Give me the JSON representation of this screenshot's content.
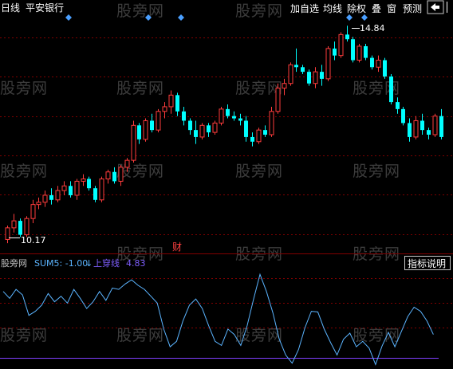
{
  "header": {
    "period": "日线",
    "stock_name": "平安银行",
    "toolbar": [
      "加自选",
      "均线",
      "除权",
      "叠",
      "窗",
      "预测"
    ],
    "nav_icon": "left-arrow-icon"
  },
  "price_labels": {
    "high": "14.84",
    "low": "10.17"
  },
  "event_marker": "财",
  "indicator_legend": {
    "name": "股旁网",
    "sum5": "SUM5: -1.00",
    "signal": "上穿线",
    "signal_value": "4.83"
  },
  "indicator_button": "指标说明",
  "watermark": "股旁网",
  "colors": {
    "up": "#ff3c3c",
    "down": "#00ffff",
    "grid": "#800000",
    "indicator_line": "#5bb4ff",
    "signal_line": "#7f3fff",
    "marker": "#4a9fff"
  },
  "chart_data": {
    "type": "candlestick",
    "ohlc": [
      [
        10.25,
        10.55,
        10.17,
        10.5
      ],
      [
        10.5,
        10.8,
        10.4,
        10.65
      ],
      [
        10.65,
        10.7,
        10.3,
        10.35
      ],
      [
        10.35,
        10.75,
        10.3,
        10.7
      ],
      [
        10.7,
        11.1,
        10.6,
        11.0
      ],
      [
        11.0,
        11.15,
        10.9,
        11.05
      ],
      [
        11.05,
        11.3,
        10.95,
        11.2
      ],
      [
        11.2,
        11.35,
        11.0,
        11.1
      ],
      [
        11.1,
        11.4,
        11.05,
        11.3
      ],
      [
        11.3,
        11.5,
        11.2,
        11.4
      ],
      [
        11.4,
        11.5,
        11.15,
        11.2
      ],
      [
        11.2,
        11.55,
        11.1,
        11.5
      ],
      [
        11.5,
        11.65,
        11.4,
        11.55
      ],
      [
        11.55,
        11.6,
        11.3,
        11.35
      ],
      [
        11.35,
        11.4,
        11.05,
        11.1
      ],
      [
        11.1,
        11.6,
        11.05,
        11.55
      ],
      [
        11.55,
        11.75,
        11.45,
        11.7
      ],
      [
        11.7,
        11.8,
        11.45,
        11.5
      ],
      [
        11.5,
        11.85,
        11.4,
        11.8
      ],
      [
        11.8,
        12.0,
        11.7,
        11.95
      ],
      [
        11.95,
        12.8,
        11.9,
        12.7
      ],
      [
        12.7,
        12.75,
        12.3,
        12.4
      ],
      [
        12.4,
        12.85,
        12.35,
        12.8
      ],
      [
        12.8,
        12.95,
        12.55,
        12.6
      ],
      [
        12.6,
        13.05,
        12.55,
        13.0
      ],
      [
        13.0,
        13.2,
        12.85,
        13.1
      ],
      [
        13.1,
        13.45,
        12.95,
        13.35
      ],
      [
        13.35,
        13.4,
        12.9,
        13.0
      ],
      [
        13.0,
        13.1,
        12.7,
        12.8
      ],
      [
        12.8,
        12.85,
        12.5,
        12.6
      ],
      [
        12.6,
        12.8,
        12.3,
        12.45
      ],
      [
        12.45,
        12.75,
        12.4,
        12.7
      ],
      [
        12.7,
        12.75,
        12.45,
        12.55
      ],
      [
        12.55,
        12.8,
        12.5,
        12.75
      ],
      [
        12.75,
        13.1,
        12.7,
        13.05
      ],
      [
        13.05,
        13.15,
        12.85,
        12.9
      ],
      [
        12.9,
        13.0,
        12.8,
        12.85
      ],
      [
        12.85,
        12.95,
        12.7,
        12.8
      ],
      [
        12.8,
        12.9,
        12.35,
        12.45
      ],
      [
        12.45,
        12.55,
        12.25,
        12.35
      ],
      [
        12.35,
        12.65,
        12.3,
        12.6
      ],
      [
        12.6,
        12.7,
        12.45,
        12.5
      ],
      [
        12.5,
        13.1,
        12.45,
        13.0
      ],
      [
        13.0,
        13.6,
        12.95,
        13.5
      ],
      [
        13.5,
        13.7,
        13.35,
        13.6
      ],
      [
        13.6,
        14.05,
        13.55,
        14.0
      ],
      [
        14.0,
        14.35,
        13.85,
        13.95
      ],
      [
        13.95,
        14.0,
        13.8,
        13.85
      ],
      [
        13.85,
        13.9,
        13.55,
        13.6
      ],
      [
        13.6,
        13.95,
        13.5,
        13.85
      ],
      [
        13.85,
        14.0,
        13.55,
        13.7
      ],
      [
        13.7,
        14.4,
        13.65,
        14.35
      ],
      [
        14.35,
        14.5,
        14.1,
        14.2
      ],
      [
        14.2,
        14.7,
        14.15,
        14.65
      ],
      [
        14.65,
        14.84,
        14.5,
        14.55
      ],
      [
        14.55,
        14.6,
        14.05,
        14.1
      ],
      [
        14.1,
        14.45,
        14.05,
        14.4
      ],
      [
        14.4,
        14.45,
        14.1,
        14.15
      ],
      [
        14.15,
        14.2,
        13.9,
        13.95
      ],
      [
        13.95,
        14.2,
        13.85,
        14.1
      ],
      [
        14.1,
        14.15,
        13.7,
        13.75
      ],
      [
        13.75,
        13.8,
        13.15,
        13.2
      ],
      [
        13.2,
        13.3,
        12.95,
        13.05
      ],
      [
        13.05,
        13.1,
        12.7,
        12.75
      ],
      [
        12.75,
        12.85,
        12.35,
        12.45
      ],
      [
        12.45,
        12.9,
        12.4,
        12.8
      ],
      [
        12.8,
        12.95,
        12.5,
        12.6
      ],
      [
        12.6,
        12.65,
        12.4,
        12.5
      ],
      [
        12.5,
        12.95,
        12.45,
        12.9
      ],
      [
        12.9,
        13.05,
        12.4,
        12.45
      ]
    ],
    "ylim": [
      9.95,
      15.05
    ],
    "highlight_high": 14.84,
    "highlight_low": 10.17,
    "indicator": {
      "name": "SUM5",
      "last": -1.0,
      "signal_value": 4.83,
      "values": [
        6.5,
        5.5,
        6.8,
        6.0,
        3.0,
        3.6,
        4.5,
        6.2,
        5.0,
        5.8,
        4.8,
        6.8,
        5.5,
        4.0,
        5.0,
        6.5,
        5.2,
        7.0,
        6.8,
        7.6,
        8.2,
        7.4,
        6.8,
        5.8,
        4.8,
        1.0,
        -1.6,
        -0.8,
        2.2,
        4.5,
        5.4,
        4.0,
        1.5,
        -0.8,
        -1.4,
        1.0,
        0.2,
        -1.4,
        1.5,
        5.4,
        9.0,
        6.5,
        3.4,
        -0.5,
        -2.8,
        -4.0,
        -2.0,
        1.2,
        3.6,
        3.5,
        1.0,
        -1.0,
        -2.8,
        -0.5,
        0.4,
        -1.6,
        -0.8,
        -1.8,
        -4.2,
        -1.5,
        0.5,
        -1.6,
        0.6,
        2.8,
        4.2,
        3.6,
        2.2,
        0.2
      ],
      "ylim": [
        -4.5,
        9.5
      ]
    }
  }
}
